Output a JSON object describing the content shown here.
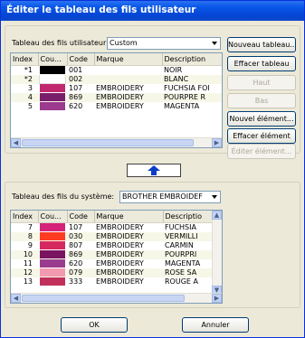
{
  "window": {
    "title": "Éditer le tableau des fils utilisateur"
  },
  "user_table": {
    "label": "Tableau des fils utilisateur:",
    "selected": "Custom",
    "columns": [
      "Index",
      "Cou...",
      "Code",
      "Marque",
      "Description"
    ],
    "rows": [
      {
        "index": "*1",
        "color": "#000000",
        "code": "001",
        "brand": "",
        "desc": "NOIR"
      },
      {
        "index": "*2",
        "color": "#ffffff",
        "code": "002",
        "brand": "",
        "desc": "BLANC"
      },
      {
        "index": "3",
        "color": "#c2286e",
        "code": "107",
        "brand": "EMBROIDERY",
        "desc": "FUCHSIA FOI"
      },
      {
        "index": "4",
        "color": "#7a1e6b",
        "code": "869",
        "brand": "EMBROIDERY",
        "desc": "POURPRE R"
      },
      {
        "index": "5",
        "color": "#9b3a8e",
        "code": "620",
        "brand": "EMBROIDERY",
        "desc": "MAGENTA"
      }
    ]
  },
  "side_buttons": {
    "new_table": "Nouveau tableau...",
    "delete_table": "Effacer tableau",
    "up": "Haut",
    "down": "Bas",
    "new_element": "Nouvel élément...",
    "delete_element": "Effacer élément",
    "edit_element": "Éditer élément..."
  },
  "system_table": {
    "label": "Tableau des fils du système:",
    "selected": "BROTHER EMBROIDEF",
    "columns": [
      "Index",
      "Cou...",
      "Code",
      "Marque",
      "Descriptio"
    ],
    "rows": [
      {
        "index": "7",
        "color": "#d6237a",
        "code": "107",
        "brand": "EMBROIDERY",
        "desc": "FUCHSIA"
      },
      {
        "index": "8",
        "color": "#ff3b22",
        "code": "030",
        "brand": "EMBROIDERY",
        "desc": "VERMILLI"
      },
      {
        "index": "9",
        "color": "#d4285e",
        "code": "807",
        "brand": "EMBROIDERY",
        "desc": "CARMIN"
      },
      {
        "index": "10",
        "color": "#7a1460",
        "code": "869",
        "brand": "EMBROIDERY",
        "desc": "POURPRI"
      },
      {
        "index": "11",
        "color": "#9a3c8e",
        "code": "620",
        "brand": "EMBROIDERY",
        "desc": "MAGENTA"
      },
      {
        "index": "12",
        "color": "#f29ab0",
        "code": "079",
        "brand": "EMBROIDERY",
        "desc": "ROSE SA"
      },
      {
        "index": "13",
        "color": "#c0305a",
        "code": "333",
        "brand": "EMBROIDERY",
        "desc": "ROUGE A"
      }
    ]
  },
  "footer": {
    "ok": "OK",
    "cancel": "Annuler"
  }
}
